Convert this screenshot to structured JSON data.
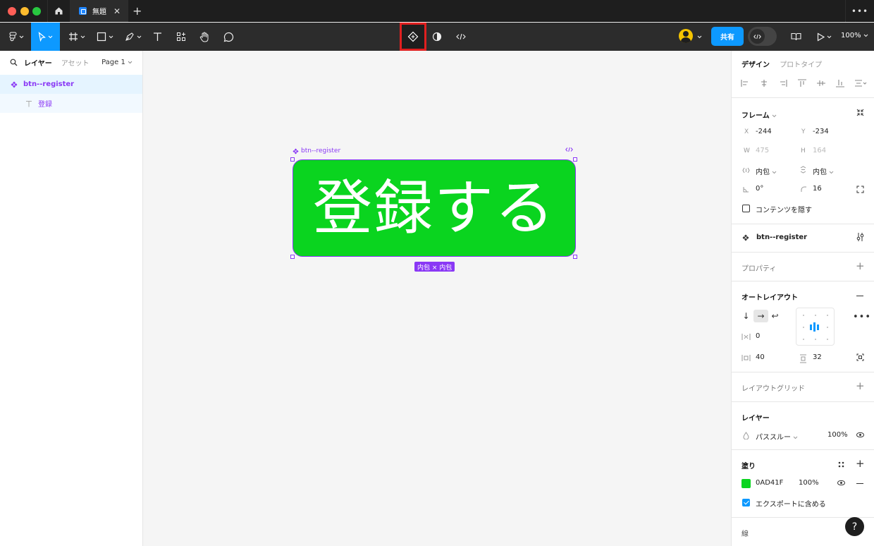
{
  "titlebar": {
    "tab_title": "無題",
    "close_glyph": "✕",
    "new_tab_glyph": "+",
    "more_glyph": "•••"
  },
  "toolbar": {
    "share_label": "共有",
    "zoom": "100%",
    "tools": [
      "main-menu-icon",
      "move-icon",
      "frame-icon",
      "shape-icon",
      "pen-icon",
      "text-icon",
      "resources-icon",
      "hand-icon",
      "comment-icon",
      "create-component-icon",
      "mask-icon",
      "code-icon"
    ]
  },
  "left_panel": {
    "tabs": {
      "layers": "レイヤー",
      "assets": "アセット"
    },
    "page": "Page 1",
    "layers": [
      {
        "name": "btn--register",
        "type": "component"
      },
      {
        "name": "登録",
        "type": "text"
      }
    ]
  },
  "canvas": {
    "frame_label": "btn--register",
    "button_text": "登録する",
    "button_color": "#0AD41F",
    "size_badge": "内包 × 内包"
  },
  "right_panel": {
    "tabs": {
      "design": "デザイン",
      "prototype": "プロトタイプ"
    },
    "frame": {
      "title": "フレーム",
      "x_label": "X",
      "x": "-244",
      "y_label": "Y",
      "y": "-234",
      "w_label": "W",
      "w": "475",
      "h_label": "H",
      "h": "164",
      "w_mode": "内包",
      "h_mode": "内包",
      "rotation": "0°",
      "radius": "16",
      "clip_label": "コンテンツを隠す"
    },
    "component": {
      "name": "btn--register"
    },
    "properties": {
      "title": "プロパティ"
    },
    "autolayout": {
      "title": "オートレイアウト",
      "gap": "0",
      "padding_h": "40",
      "padding_v": "32"
    },
    "layout_grid": {
      "title": "レイアウトグリッド"
    },
    "layer": {
      "title": "レイヤー",
      "blend": "パススルー",
      "opacity": "100%"
    },
    "fill": {
      "title": "塗り",
      "hex": "0AD41F",
      "opacity": "100%",
      "export_label": "エクスポートに含める"
    },
    "stroke": {
      "title": "線"
    }
  },
  "help": "?"
}
